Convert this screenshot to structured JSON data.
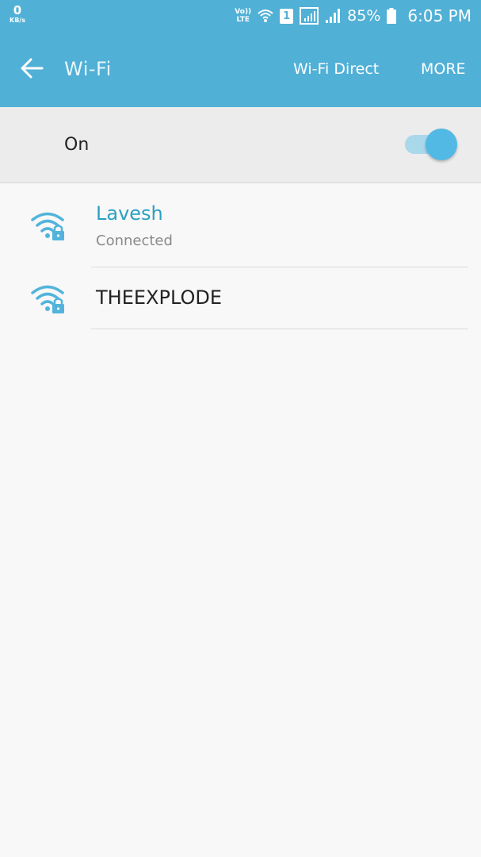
{
  "status_bar": {
    "speed_value": "0",
    "speed_unit": "KB/s",
    "volte_top": "Vo))",
    "volte_bottom": "LTE",
    "sim_number": "1",
    "battery_percent": "85%",
    "time": "6:05 PM"
  },
  "app_bar": {
    "title": "Wi-Fi",
    "wifi_direct_label": "Wi-Fi Direct",
    "more_label": "MORE"
  },
  "wifi_toggle": {
    "label": "On",
    "enabled": true
  },
  "networks": [
    {
      "name": "Lavesh",
      "status": "Connected",
      "secured": true,
      "connected": true
    },
    {
      "name": "THEEXPLODE",
      "status": "",
      "secured": true,
      "connected": false
    }
  ],
  "colors": {
    "accent": "#51b0d6",
    "connected_text": "#2a9fc4",
    "toggle_thumb": "#51b9e3",
    "toggle_track": "#a9d8eb",
    "wifi_icon": "#52b4dc"
  }
}
